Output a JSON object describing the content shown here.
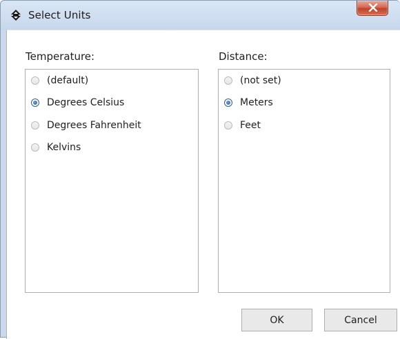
{
  "window": {
    "title": "Select Units",
    "close_symbol": "x",
    "icon": "app-diamond-icon"
  },
  "temperature": {
    "label": "Temperature:",
    "options": [
      {
        "label": "(default)",
        "checked": false
      },
      {
        "label": "Degrees Celsius",
        "checked": true
      },
      {
        "label": "Degrees Fahrenheit",
        "checked": false
      },
      {
        "label": "Kelvins",
        "checked": false
      }
    ]
  },
  "distance": {
    "label": "Distance:",
    "options": [
      {
        "label": "(not set)",
        "checked": false
      },
      {
        "label": "Meters",
        "checked": true
      },
      {
        "label": "Feet",
        "checked": false
      }
    ]
  },
  "buttons": {
    "ok": "OK",
    "cancel": "Cancel"
  },
  "colors": {
    "titlebar": "#c9d8eb",
    "close_button": "#c7472f",
    "radio_selected": "#1f5aa0",
    "listbox_border": "#abadb3"
  }
}
